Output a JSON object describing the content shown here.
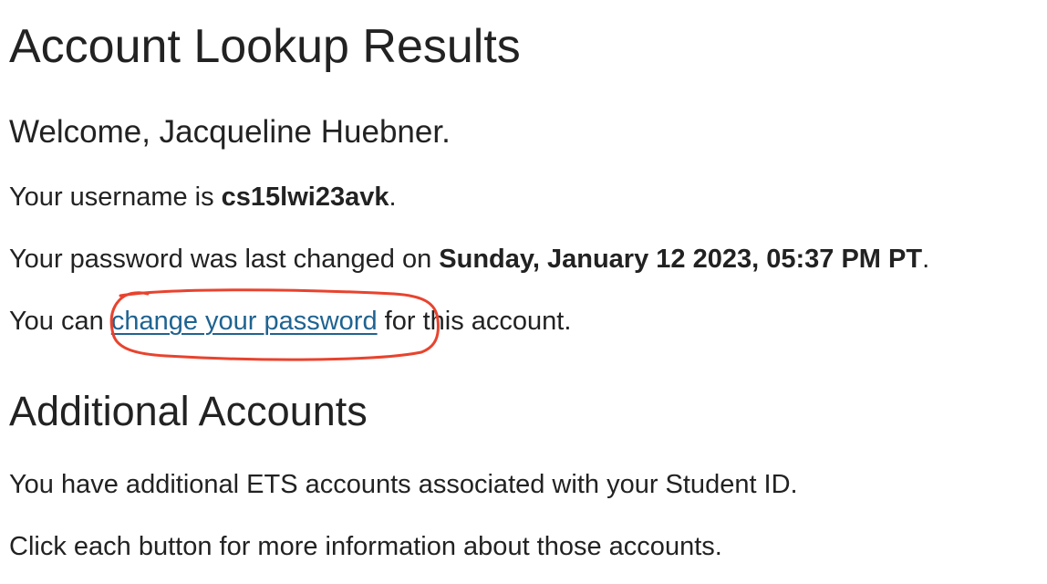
{
  "page": {
    "title": "Account Lookup Results",
    "welcome": "Welcome, Jacqueline Huebner.",
    "username_prefix": "Your username is ",
    "username": "cs15lwi23avk",
    "username_suffix": ".",
    "password_prefix": "Your password was last changed on ",
    "password_changed": "Sunday, January 12 2023, 05:37 PM PT",
    "password_suffix": ".",
    "change_prefix": "You can ",
    "change_link": "change your password",
    "change_suffix": " for this account."
  },
  "additional": {
    "heading": "Additional Accounts",
    "line1": "You have additional ETS accounts associated with your Student ID.",
    "line2": "Click each button for more information about those accounts."
  },
  "colors": {
    "text": "#222222",
    "link": "#1f6391",
    "annotation": "#e8432e"
  },
  "annotation": {
    "shape": "hand-drawn-circle"
  }
}
